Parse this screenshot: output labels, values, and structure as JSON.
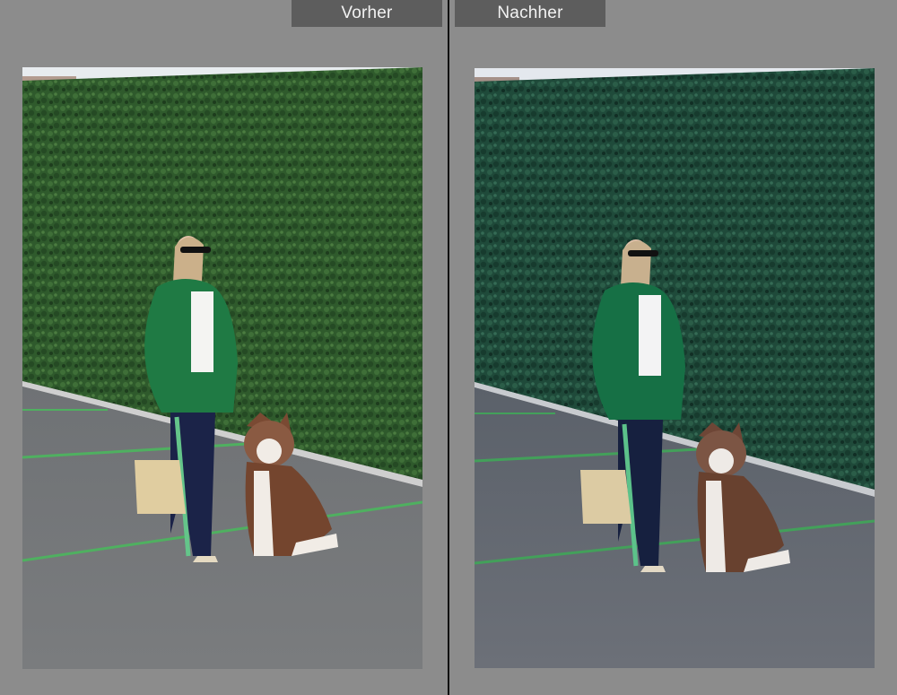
{
  "comparison": {
    "before_label": "Vorher",
    "after_label": "Nachher"
  },
  "colors": {
    "background": "#8c8c8c",
    "label_tab": "#5d5d5d",
    "divider": "#111111"
  }
}
